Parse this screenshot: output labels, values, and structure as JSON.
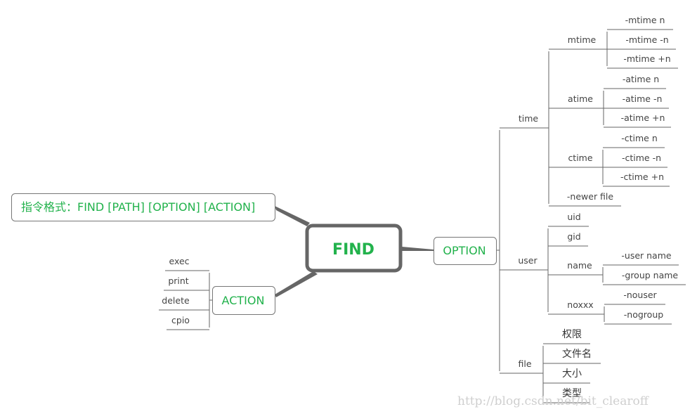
{
  "colors": {
    "accent_text": "#22b24c",
    "line": "#666666",
    "text": "#444444"
  },
  "root": {
    "label": "FIND"
  },
  "format": {
    "label": "指令格式：FIND [PATH] [OPTION] [ACTION]"
  },
  "action": {
    "label": "ACTION",
    "children": [
      "exec",
      "print",
      "delete",
      "cpio"
    ]
  },
  "option": {
    "label": "OPTION",
    "time": {
      "label": "time",
      "mtime": {
        "label": "mtime",
        "children": [
          "-mtime n",
          "-mtime -n",
          "-mtime +n"
        ]
      },
      "atime": {
        "label": "atime",
        "children": [
          "-atime n",
          "-atime -n",
          "-atime +n"
        ]
      },
      "ctime": {
        "label": "ctime",
        "children": [
          "-ctime n",
          "-ctime -n",
          "-ctime +n"
        ]
      },
      "newer": {
        "label": "-newer file"
      }
    },
    "user": {
      "label": "user",
      "uid": {
        "label": "uid"
      },
      "gid": {
        "label": "gid"
      },
      "name": {
        "label": "name",
        "children": [
          "-user name",
          "-group name"
        ]
      },
      "noxxx": {
        "label": "noxxx",
        "children": [
          "-nouser",
          "-nogroup"
        ]
      }
    },
    "file": {
      "label": "file",
      "children": [
        "权限",
        "文件名",
        "大小",
        "类型"
      ]
    }
  },
  "watermark": "http://blog.csdn.net/bit_clearoff"
}
